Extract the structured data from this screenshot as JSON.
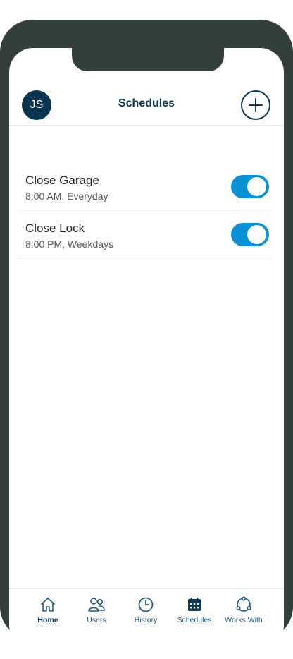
{
  "header": {
    "avatar_initials": "JS",
    "title": "Schedules"
  },
  "schedules": [
    {
      "name": "Close Garage",
      "detail": "8:00 AM, Everyday",
      "enabled": true
    },
    {
      "name": "Close Lock",
      "detail": "8:00 PM, Weekdays",
      "enabled": true
    }
  ],
  "tabs": [
    {
      "label": "Home",
      "icon": "home-icon",
      "active": true
    },
    {
      "label": "Users",
      "icon": "users-icon",
      "active": false
    },
    {
      "label": "History",
      "icon": "clock-icon",
      "active": false
    },
    {
      "label": "Schedules",
      "icon": "calendar-icon",
      "active": false
    },
    {
      "label": "Works With",
      "icon": "works-with-icon",
      "active": false
    }
  ],
  "colors": {
    "primary": "#0d3a57",
    "toggle_on": "#0b91d6",
    "frame": "#334039"
  }
}
